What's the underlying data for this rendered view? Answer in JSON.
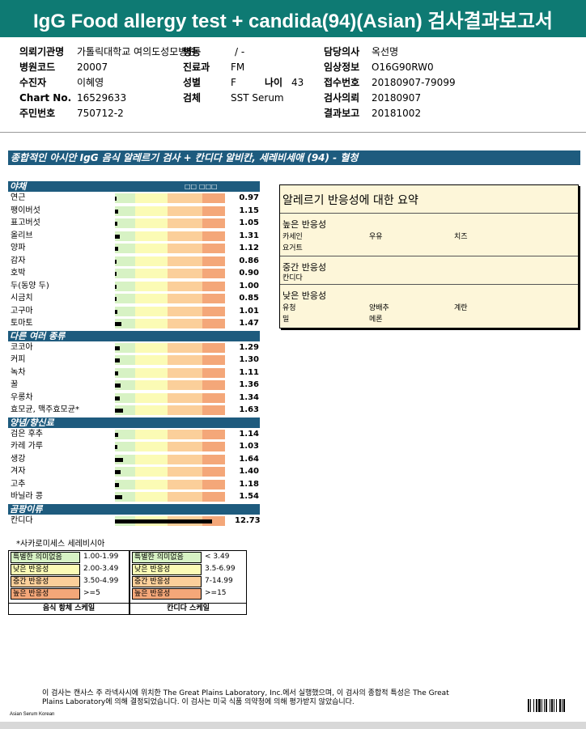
{
  "title": "IgG Food allergy test + candida(94)(Asian) 검사결과보고서",
  "header": {
    "col1": [
      {
        "label": "의뢰기관명",
        "value": "가톨릭대학교 여의도성모병원"
      },
      {
        "label": "병원코드",
        "value": "20007"
      },
      {
        "label": "수진자",
        "value": "이혜영"
      },
      {
        "label": "Chart No.",
        "value": "16529633"
      },
      {
        "label": "주민번호",
        "value": "750712-2"
      }
    ],
    "ward": {
      "label": "병동",
      "value": "/ -"
    },
    "dept": {
      "label": "진료과",
      "value": "FM"
    },
    "sex": {
      "label": "성별",
      "value": "F"
    },
    "age": {
      "label": "나이",
      "value": "43"
    },
    "specimen": {
      "label": "검체",
      "value": "SST Serum"
    },
    "col3": [
      {
        "label": "담당의사",
        "value": "옥선명"
      },
      {
        "label": "임상정보",
        "value": "O16G90RW0"
      },
      {
        "label": "접수번호",
        "value": "20180907-79099"
      },
      {
        "label": "검사의뢰",
        "value": "20180907"
      },
      {
        "label": "결과보고",
        "value": "20181002"
      }
    ]
  },
  "section_title": "종합적인 아시안 IgG 음식 알레르기 검사 + 칸디다 알비칸, 세레비세애 (94) - 혈청",
  "scale_header": "□□ □□□",
  "categories": [
    {
      "name": "야채",
      "items": [
        {
          "label": "연근",
          "value": "0.97",
          "level": 0.97
        },
        {
          "label": "팽이버섯",
          "value": "1.15",
          "level": 1.15
        },
        {
          "label": "표고버섯",
          "value": "1.05",
          "level": 1.05
        },
        {
          "label": "올리브",
          "value": "1.31",
          "level": 1.31
        },
        {
          "label": "양파",
          "value": "1.12",
          "level": 1.12
        },
        {
          "label": "감자",
          "value": "0.86",
          "level": 0.86
        },
        {
          "label": "호박",
          "value": "0.90",
          "level": 0.9
        },
        {
          "label": "두(동양 두)",
          "value": "1.00",
          "level": 1.0
        },
        {
          "label": "시금치",
          "value": "0.85",
          "level": 0.85
        },
        {
          "label": "고구마",
          "value": "1.01",
          "level": 1.01
        },
        {
          "label": "토마토",
          "value": "1.47",
          "level": 1.47
        }
      ]
    },
    {
      "name": "다른 여러 종류",
      "items": [
        {
          "label": "코코아",
          "value": "1.29",
          "level": 1.29
        },
        {
          "label": "커피",
          "value": "1.30",
          "level": 1.3
        },
        {
          "label": "녹차",
          "value": "1.11",
          "level": 1.11
        },
        {
          "label": "꿀",
          "value": "1.36",
          "level": 1.36
        },
        {
          "label": "우롱차",
          "value": "1.34",
          "level": 1.34
        },
        {
          "label": "효모균, 맥주효모균*",
          "value": "1.63",
          "level": 1.63
        }
      ]
    },
    {
      "name": "양념/향신료",
      "items": [
        {
          "label": "검은 후추",
          "value": "1.14",
          "level": 1.14
        },
        {
          "label": "카레 가루",
          "value": "1.03",
          "level": 1.03
        },
        {
          "label": "생강",
          "value": "1.64",
          "level": 1.64
        },
        {
          "label": "겨자",
          "value": "1.40",
          "level": 1.4
        },
        {
          "label": "고추",
          "value": "1.18",
          "level": 1.18
        },
        {
          "label": "바닐라 콩",
          "value": "1.54",
          "level": 1.54
        }
      ]
    },
    {
      "name": "곰팡이류",
      "items": [
        {
          "label": "칸디다",
          "value": "12.73",
          "level": 12.73
        }
      ]
    }
  ],
  "footnote": "*사카로미세스 세레비시아",
  "summary": {
    "title": "알레르기 반응성에 대한 요약",
    "groups": [
      {
        "name": "높은 반응성",
        "items": [
          "카세인",
          "우유",
          "치즈",
          "요거트"
        ]
      },
      {
        "name": "중간 반응성",
        "items": [
          "칸디다"
        ]
      },
      {
        "name": "낮은 반응성",
        "items": [
          "유청",
          "양배추",
          "계란",
          "밀",
          "메론"
        ]
      }
    ]
  },
  "legend": {
    "food": {
      "caption": "음식 항체 스케일",
      "rows": [
        {
          "label": "특별한 의미없음",
          "range": "1.00-1.99",
          "color": "#d7f2c4"
        },
        {
          "label": "낮은 반응성",
          "range": "2.00-3.49",
          "color": "#fbfbb5"
        },
        {
          "label": "중간 반응성",
          "range": "3.50-4.99",
          "color": "#fbcf9a"
        },
        {
          "label": "높은 반응성",
          "range": ">=5",
          "color": "#f4a779"
        }
      ]
    },
    "candida": {
      "caption": "칸디다 스케일",
      "rows": [
        {
          "label": "특별한 의미없음",
          "range": "< 3.49",
          "color": "#d7f2c4"
        },
        {
          "label": "낮은 반응성",
          "range": "3.5-6.99",
          "color": "#fbfbb5"
        },
        {
          "label": "중간 반응성",
          "range": "7-14.99",
          "color": "#fbcf9a"
        },
        {
          "label": "높은 반응성",
          "range": ">=15",
          "color": "#f4a779"
        }
      ]
    }
  },
  "footer": {
    "line1": "이 검사는 캔사스 주 라넥사시에 위치한 The Great Plains Laboratory, Inc.에서 실행했으며,  이 검사의 종합적 특성은 The Great",
    "line2": "Plains Laboratory에 의해 결정되었습니다. 이 검사는 미국 식품 의약청에 의해 평가받지 않았습니다.",
    "corner": "Asian Serum Korean"
  },
  "colors": {
    "title_bar": "#0e7a73",
    "section_bar": "#1e5b7e",
    "summary_bg": "#fdf6d9"
  }
}
